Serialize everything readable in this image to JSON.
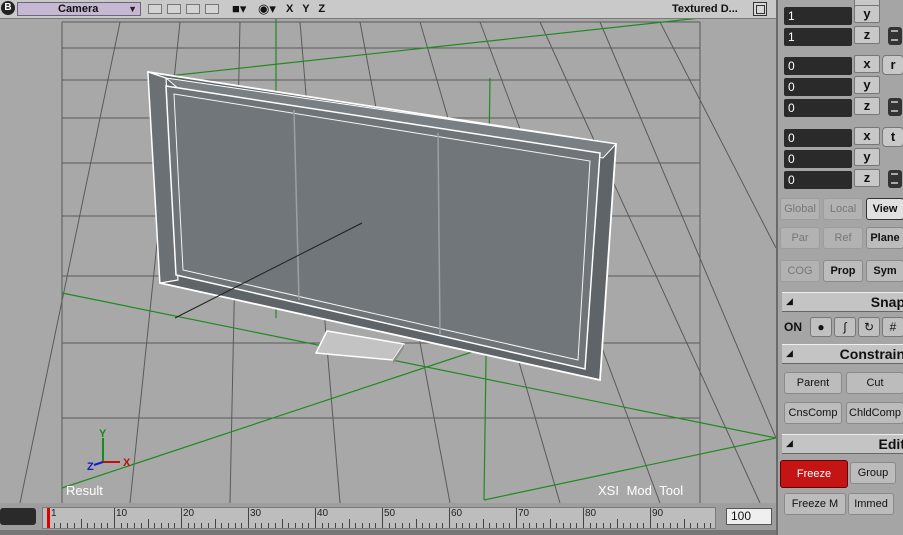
{
  "viewport": {
    "camera_label": "Camera",
    "axes_label": "X Y Z",
    "display_mode": "Textured D...",
    "result_label": "Result",
    "tool_label": "XSI Mod Tool",
    "axis_x": "X",
    "axis_y": "Y",
    "axis_z": "Z"
  },
  "timeline": {
    "current_frame": "1",
    "end_frame": "100",
    "ticks": [
      "10",
      "20",
      "30",
      "40",
      "50",
      "60",
      "70",
      "80",
      "90"
    ]
  },
  "panel": {
    "scale_y_value": "1",
    "scale_z_value": "1",
    "rotate": {
      "x": "0",
      "y": "0",
      "z": "0"
    },
    "translate": {
      "x": "0",
      "y": "0",
      "z": "0"
    },
    "axis_labels": {
      "x": "x",
      "y": "y",
      "z": "z"
    },
    "side_caps": {
      "r": "r",
      "t": "t"
    },
    "ref_buttons": [
      "Global",
      "Local",
      "View",
      "Par",
      "Ref",
      "Plane",
      "COG",
      "Prop",
      "Sym"
    ],
    "snap": {
      "title": "Snap",
      "on": "ON"
    },
    "constrain": {
      "title": "Constrain",
      "buttons": [
        "Parent",
        "Cut",
        "CnsComp",
        "ChldComp"
      ]
    },
    "edit": {
      "title": "Edit",
      "buttons": [
        "Freeze",
        "Group",
        "Freeze M",
        "Immed"
      ]
    }
  },
  "colors": {
    "grid": "#5a5a5a",
    "grid_line_green": "#1f8a1f",
    "freeze_button": "#c41414",
    "camera_select": "#c6b7d3"
  }
}
